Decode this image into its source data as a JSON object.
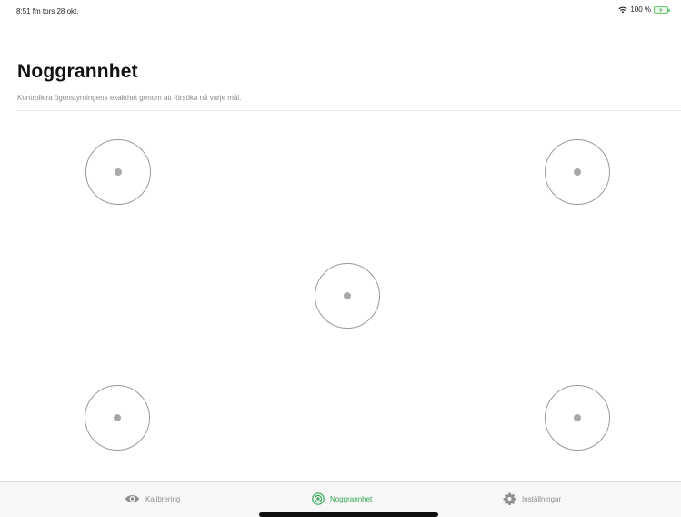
{
  "status_bar": {
    "time": "8:51 fm  tors 28 okt.",
    "battery": "100 %",
    "battery_color": "#6cc870"
  },
  "header": {
    "title": "Noggrannhet",
    "subtitle": "Kontrollera ögonstyrningens exakthet genom att försöka nå varje mål."
  },
  "targets": [
    {
      "name": "target-top-left"
    },
    {
      "name": "target-top-right"
    },
    {
      "name": "target-center"
    },
    {
      "name": "target-bottom-left"
    },
    {
      "name": "target-bottom-right"
    }
  ],
  "tab_bar": {
    "tabs": [
      {
        "label": "Kalibrering",
        "icon": "eye-icon",
        "active": false
      },
      {
        "label": "Noggrannhet",
        "icon": "target-icon",
        "active": true
      },
      {
        "label": "Inställningar",
        "icon": "gear-icon",
        "active": false
      }
    ],
    "active_color": "#34a853",
    "inactive_color": "#8e8e8e"
  }
}
